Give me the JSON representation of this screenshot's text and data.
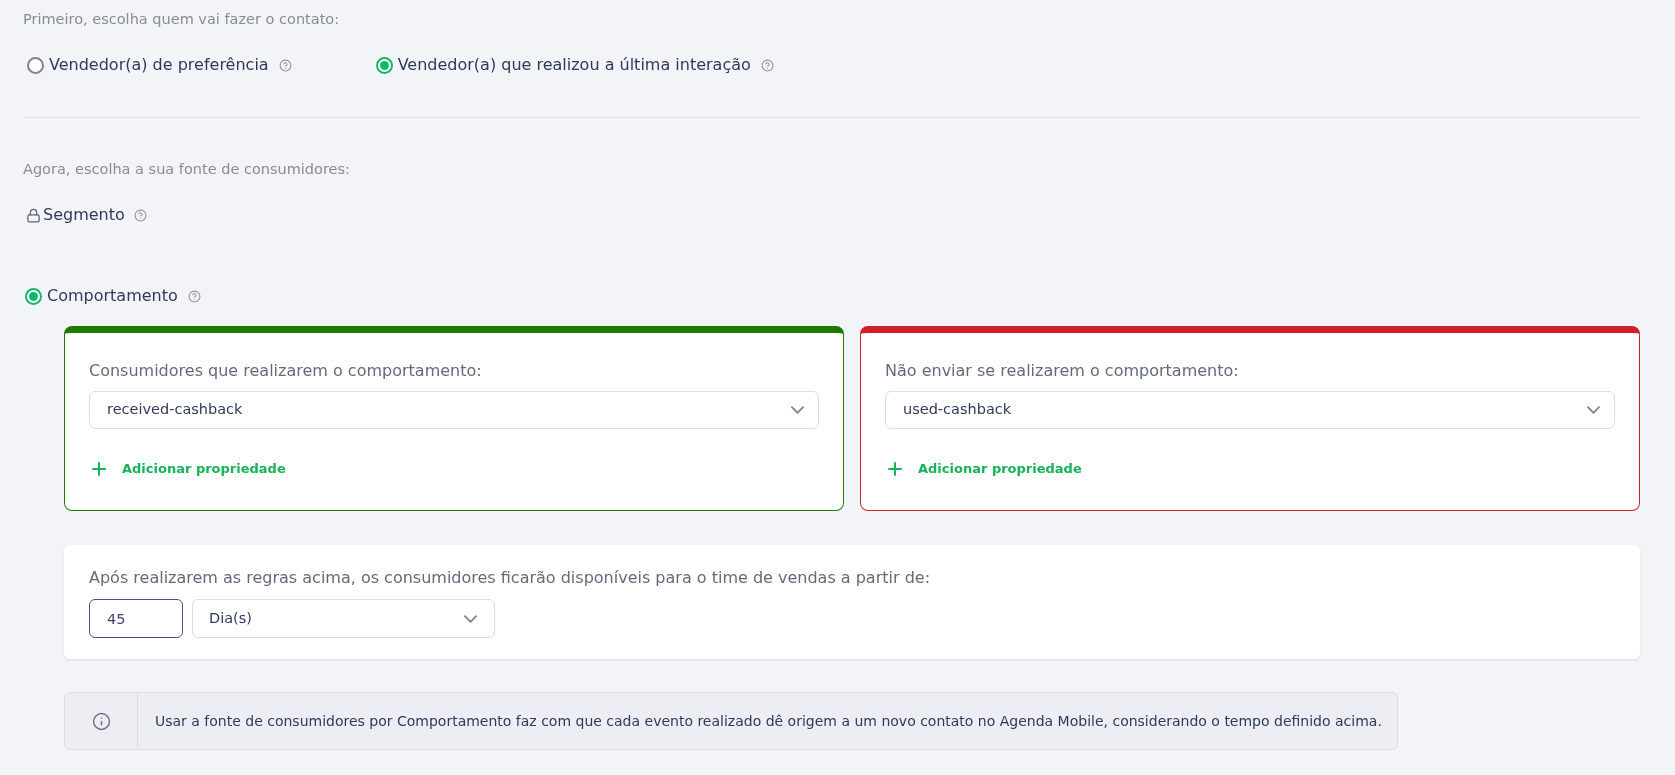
{
  "contact_section": {
    "prompt": "Primeiro, escolha quem vai fazer o contato:",
    "options": [
      {
        "label": "Vendedor(a) de preferência",
        "selected": false
      },
      {
        "label": "Vendedor(a) que realizou a última interação",
        "selected": true
      }
    ]
  },
  "source_section": {
    "prompt": "Agora, escolha a sua fonte de consumidores:",
    "options": [
      {
        "kind": "locked",
        "label": "Segmento"
      },
      {
        "kind": "radio",
        "label": "Comportamento",
        "selected": true
      }
    ]
  },
  "behavior_cards": [
    {
      "label": "Consumidores que realizarem o comportamento:",
      "value": "received-cashback",
      "add_label": "Adicionar propriedade",
      "color": "#1f7a05"
    },
    {
      "label": "Não enviar se realizarem o comportamento:",
      "value": "used-cashback",
      "add_label": "Adicionar propriedade",
      "color": "#d21f2b"
    }
  ],
  "availability": {
    "text": "Após realizarem as regras acima, os consumidores ficarão disponíveis para o time de vendas a partir de:",
    "amount": "45",
    "unit": "Dia(s)"
  },
  "info_note": "Usar a fonte de consumidores por Comportamento faz com que cada evento realizado dê origem a um novo contato no Agenda Mobile, considerando o tempo definido acima."
}
